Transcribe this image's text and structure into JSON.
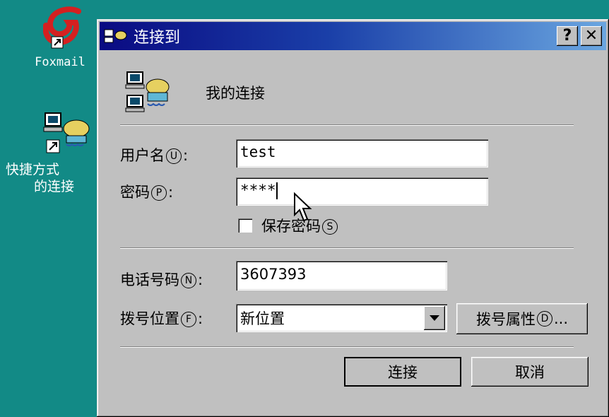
{
  "desktop": {
    "icons": [
      {
        "label": "Foxmail",
        "icon": "foxmail-icon"
      },
      {
        "label_line1": "快捷方式",
        "label_line2": "的连接",
        "icon": "dialup-connection-icon"
      }
    ]
  },
  "dialog": {
    "title": "连接到",
    "help_button": "?",
    "close_button": "✕",
    "connection_name": "我的连接",
    "username_label": "用户名",
    "username_key": "U",
    "username_value": "test",
    "password_label": "密码",
    "password_key": "P",
    "password_value": "****",
    "save_password_label": "保存密码",
    "save_password_key": "S",
    "save_password_checked": false,
    "phone_label": "电话号码",
    "phone_key": "N",
    "phone_value": "3607393",
    "dial_from_label": "拨号位置",
    "dial_from_key": "F",
    "dial_from_value": "新位置",
    "dial_properties_label": "拨号属性",
    "dial_properties_key": "D",
    "connect_button": "连接",
    "cancel_button": "取消"
  },
  "colors": {
    "desktop": "#128a86",
    "titlebar": "#0a0a82",
    "dialog": "#c0c0c0"
  }
}
